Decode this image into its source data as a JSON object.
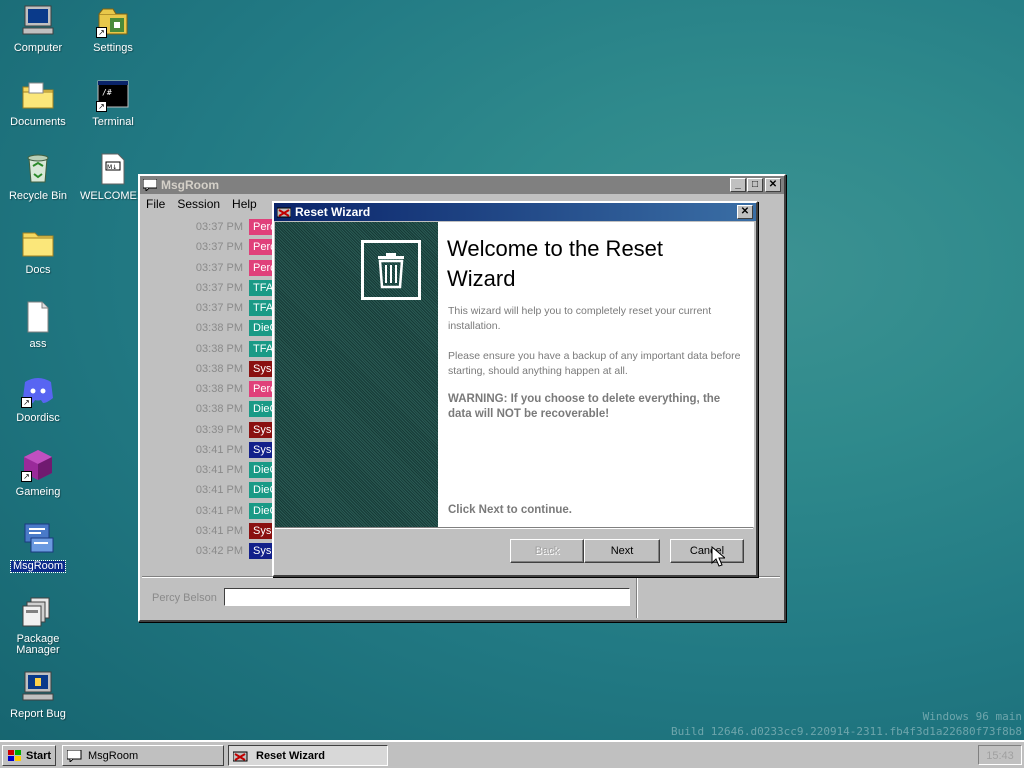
{
  "desktop": {
    "icons": [
      {
        "label": "Computer",
        "icon": "computer-icon"
      },
      {
        "label": "Settings",
        "icon": "settings-icon"
      },
      {
        "label": "Documents",
        "icon": "folder-icon"
      },
      {
        "label": "Terminal",
        "icon": "terminal-icon"
      },
      {
        "label": "Recycle Bin",
        "icon": "recycle-bin-icon"
      },
      {
        "label": "WELCOME...",
        "icon": "document-icon"
      },
      {
        "label": "Docs",
        "icon": "folder-icon"
      },
      {
        "label": "ass",
        "icon": "blank-file-icon"
      },
      {
        "label": "Doordisc",
        "icon": "discord-icon"
      },
      {
        "label": "Gameing",
        "icon": "cube-icon"
      },
      {
        "label": "MsgRoom",
        "icon": "msgroom-icon"
      },
      {
        "label": "Package Manager",
        "icon": "package-icon"
      },
      {
        "label": "Report Bug",
        "icon": "bug-report-icon"
      }
    ],
    "watermark": {
      "line1": "Windows 96 main",
      "line2": "Build 12646.d0233cc9.220914-2311.fb4f3d1a22680f73f8b8"
    }
  },
  "msgroom": {
    "title": "MsgRoom",
    "menu": [
      "File",
      "Session",
      "Help"
    ],
    "messages": [
      {
        "time": "03:37 PM",
        "user": "Percy Be",
        "color": "#e0407a"
      },
      {
        "time": "03:37 PM",
        "user": "Percy Be",
        "color": "#e0407a"
      },
      {
        "time": "03:37 PM",
        "user": "Percy Be",
        "color": "#e0407a"
      },
      {
        "time": "03:37 PM",
        "user": "TFAHD-",
        "color": "#1a9a86"
      },
      {
        "time": "03:37 PM",
        "user": "TFAHD-",
        "color": "#1a9a86"
      },
      {
        "time": "03:38 PM",
        "user": "DieGPro",
        "color": "#1a9a86"
      },
      {
        "time": "03:38 PM",
        "user": "TFAHD-",
        "color": "#1a9a86"
      },
      {
        "time": "03:38 PM",
        "user": "Sys",
        "color": "#8a1010"
      },
      {
        "time": "03:38 PM",
        "user": "Percy Be",
        "color": "#e0407a"
      },
      {
        "time": "03:38 PM",
        "user": "DieGPro",
        "color": "#1a9a86"
      },
      {
        "time": "03:39 PM",
        "user": "Sys",
        "color": "#8a1010"
      },
      {
        "time": "03:41 PM",
        "user": "Sys",
        "color": "#12208a"
      },
      {
        "time": "03:41 PM",
        "user": "DieGPro",
        "color": "#1a9a86"
      },
      {
        "time": "03:41 PM",
        "user": "DieGPro",
        "color": "#1a9a86"
      },
      {
        "time": "03:41 PM",
        "user": "DieGPro",
        "color": "#1a9a86"
      },
      {
        "time": "03:41 PM",
        "user": "Sys",
        "color": "#8a1010"
      },
      {
        "time": "03:42 PM",
        "user": "Sys",
        "color": "#12208a"
      }
    ],
    "nickname": "Percy Belson",
    "input_value": ""
  },
  "wizard": {
    "title": "Reset Wizard",
    "heading": "Welcome to the Reset Wizard",
    "para1": "This wizard will help you to completely reset your current installation.",
    "para2": "Please ensure you have a backup of any important data before starting, should anything happen at all.",
    "warning": "WARNING: If you choose to delete everything, the data will NOT be recoverable!",
    "continue_text": "Click Next to continue.",
    "back_label": "Back",
    "next_label": "Next",
    "cancel_label": "Cancel"
  },
  "taskbar": {
    "start_label": "Start",
    "tasks": [
      {
        "label": "MsgRoom"
      },
      {
        "label": "Reset Wizard"
      }
    ],
    "clock": "15:43"
  }
}
